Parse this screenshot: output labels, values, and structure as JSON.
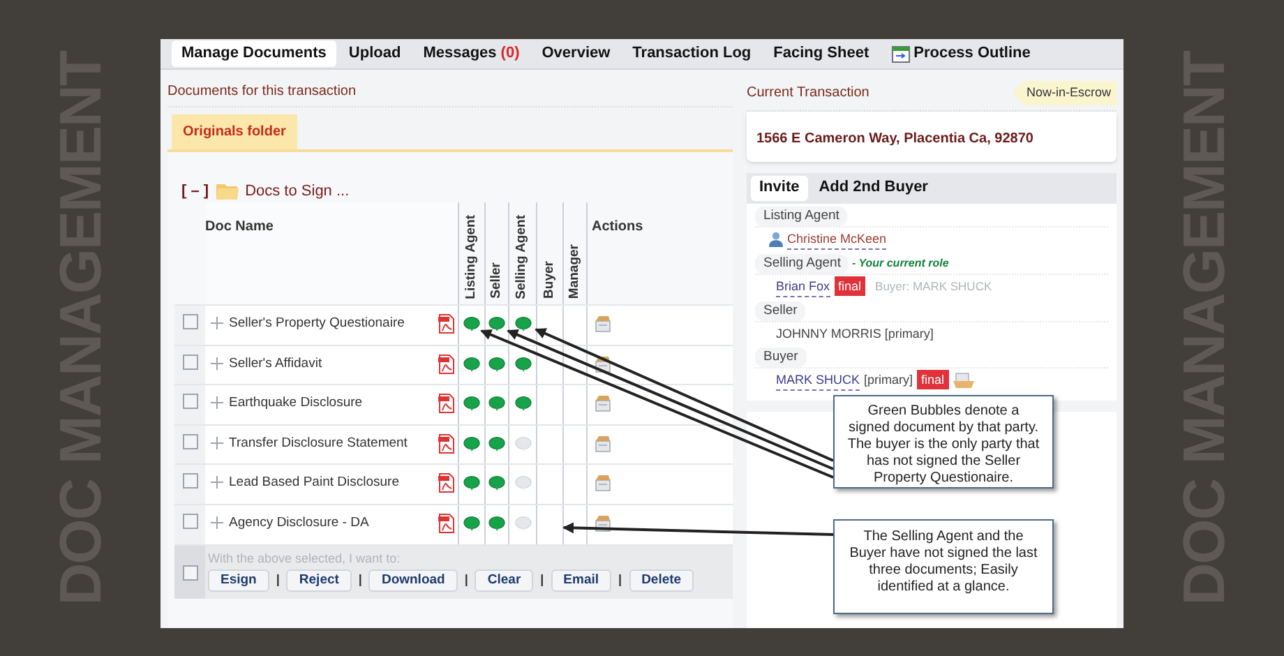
{
  "side_title": [
    "DOC MANAGEMENT",
    "DOC MANAGEMENT"
  ],
  "tabs": [
    {
      "label": "Manage Documents",
      "selected": true
    },
    {
      "label": "Upload",
      "selected": false
    },
    {
      "label": "Messages",
      "count": "(0)",
      "selected": false
    },
    {
      "label": "Overview",
      "selected": false
    },
    {
      "label": "Transaction Log",
      "selected": false
    },
    {
      "label": "Facing Sheet",
      "selected": false
    },
    {
      "label": "Process Outline",
      "has_icon": true,
      "selected": false
    }
  ],
  "documents": {
    "title": "Documents for this transaction",
    "folder_tab": "Originals folder",
    "group": {
      "toggle": "[ – ]",
      "label": "Docs to Sign ..."
    },
    "columns": [
      "Doc Name",
      "Listing Agent",
      "Seller",
      "Selling Agent",
      "Buyer",
      "Manager",
      "Actions"
    ],
    "rows": [
      {
        "name": "Seller's Property Questionaire",
        "checked": false,
        "signatures": [
          {
            "signed": true
          },
          {
            "signed": true
          },
          {
            "signed": true
          }
        ]
      },
      {
        "name": "Seller's Affidavit",
        "checked": false,
        "signatures": [
          {
            "signed": true
          },
          {
            "signed": true
          },
          {
            "signed": true
          }
        ]
      },
      {
        "name": "Earthquake Disclosure",
        "checked": false,
        "signatures": [
          {
            "signed": true
          },
          {
            "signed": true
          },
          {
            "signed": true
          }
        ]
      },
      {
        "name": "Transfer Disclosure Statement",
        "checked": false,
        "signatures": [
          {
            "signed": true
          },
          {
            "signed": true
          },
          {
            "signed": false
          }
        ]
      },
      {
        "name": "Lead Based Paint Disclosure",
        "checked": false,
        "signatures": [
          {
            "signed": true
          },
          {
            "signed": true
          },
          {
            "signed": false
          }
        ]
      },
      {
        "name": "Agency Disclosure - DA",
        "checked": false,
        "signatures": [
          {
            "signed": true
          },
          {
            "signed": true
          },
          {
            "signed": false
          }
        ]
      }
    ],
    "bulk": {
      "checked": false,
      "label": "With the above selected, I want to:",
      "separator": "|",
      "buttons": [
        "Esign",
        "Reject",
        "Download",
        "Clear",
        "Email",
        "Delete"
      ]
    }
  },
  "transaction": {
    "title": "Current Transaction",
    "status": "Now-in-Escrow",
    "address": "1566 E Cameron Way, Placentia Ca, 92870",
    "tabs": [
      {
        "label": "Invite",
        "selected": true
      },
      {
        "label": "Add 2nd Buyer",
        "selected": false
      }
    ],
    "parties": [
      {
        "role": "Listing Agent",
        "entries": [
          {
            "name": "Christine McKeen",
            "person_icon": true
          }
        ]
      },
      {
        "role": "Selling Agent",
        "note": "- Your current role",
        "entries": [
          {
            "name": "Brian Fox",
            "badge": "final",
            "extra": "Buyer: MARK SHUCK"
          }
        ]
      },
      {
        "role": "Seller",
        "entries": [
          {
            "plain": "JOHNNY MORRIS [primary]"
          }
        ]
      },
      {
        "role": "Buyer",
        "entries": [
          {
            "name": "MARK SHUCK",
            "suffix": "[primary]",
            "badge": "final",
            "doc_icon": true
          }
        ]
      }
    ]
  },
  "callouts": [
    {
      "text": "Green Bubbles denote a signed document by that party. The buyer is the only party that has not signed the Seller Property Questionaire."
    },
    {
      "text": "The Selling Agent and the Buyer have not signed the last three documents; Easily identified at a glance."
    }
  ]
}
